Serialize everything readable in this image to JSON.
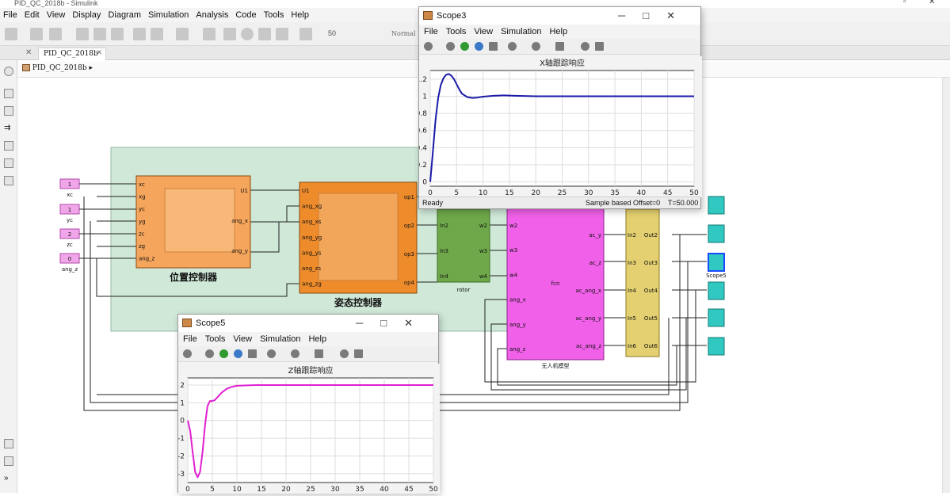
{
  "window": {
    "title": "PID_QC_2018b - Simulink",
    "menu": [
      "File",
      "Edit",
      "View",
      "Display",
      "Diagram",
      "Simulation",
      "Analysis",
      "Code",
      "Tools",
      "Help"
    ],
    "toolbar": {
      "stop_time": "50",
      "sim_mode": "Normal"
    },
    "tab_label": "PID_QC_2018b",
    "breadcrumb": "PID_QC_2018b"
  },
  "model": {
    "inputs": [
      {
        "value": "1",
        "name": "xc"
      },
      {
        "value": "1",
        "name": "yc"
      },
      {
        "value": "2",
        "name": "zc"
      },
      {
        "value": "0",
        "name": "ang_z"
      }
    ],
    "pos_controller": {
      "label": "位置控制器",
      "ports_in": [
        "xc",
        "xg",
        "yc",
        "yg",
        "zc",
        "zg",
        "ang_z"
      ],
      "ports_out": [
        "U1",
        "ang_x",
        "ang_y"
      ]
    },
    "att_controller": {
      "label": "姿态控制器",
      "ports_in": [
        "U1",
        "ang_xg",
        "ang_xs",
        "ang_yg",
        "ang_ys",
        "ang_zs",
        "ang_zg"
      ],
      "ports_out": [
        "op1",
        "op2",
        "op3",
        "op4"
      ]
    },
    "rotor": {
      "label": "rotor",
      "ports_in": [
        "In2",
        "In3",
        "In4"
      ],
      "ports_out": [
        "w2",
        "w3",
        "w4"
      ]
    },
    "uav": {
      "label": "无人机模型",
      "fcn": "fcn",
      "ports_in": [
        "w2",
        "w3",
        "w4",
        "ang_x",
        "ang_y",
        "ang_z"
      ],
      "ports_out": [
        "ac_y",
        "ac_z",
        "ac_ang_x",
        "ac_ang_y",
        "ac_ang_z"
      ]
    },
    "demux": {
      "ports_in": [
        "In2",
        "In3",
        "In4",
        "In5",
        "In6"
      ],
      "ports_out": [
        "Out2",
        "Out3",
        "Out4",
        "Out5",
        "Out6"
      ]
    },
    "scope_highlight_label": "Scope5"
  },
  "scope3": {
    "title": "Scope3",
    "menu": [
      "File",
      "Tools",
      "View",
      "Simulation",
      "Help"
    ],
    "status": {
      "ready": "Ready",
      "mode": "Sample based",
      "offset": "Offset=0",
      "time": "T=50.000"
    }
  },
  "scope5": {
    "title": "Scope5",
    "menu": [
      "File",
      "Tools",
      "View",
      "Simulation",
      "Help"
    ]
  },
  "chart_data": [
    {
      "type": "line",
      "title": "X轴跟踪响应",
      "xlabel": "",
      "ylabel": "",
      "xlim": [
        0,
        50
      ],
      "ylim": [
        -0.05,
        1.3
      ],
      "xticks": [
        0,
        5,
        10,
        15,
        20,
        25,
        30,
        35,
        40,
        45,
        50
      ],
      "yticks": [
        0,
        0.2,
        0.4,
        0.6,
        0.8,
        1,
        1.2
      ],
      "grid": true,
      "series": [
        {
          "color": "#1a1aa8",
          "x": [
            0,
            0.5,
            1,
            1.5,
            2,
            2.5,
            3,
            3.5,
            4,
            4.5,
            5,
            5.5,
            6,
            7,
            8,
            9,
            10,
            12,
            14,
            16,
            20,
            25,
            30,
            40,
            50
          ],
          "y": [
            0,
            0.35,
            0.72,
            0.98,
            1.13,
            1.21,
            1.25,
            1.26,
            1.24,
            1.2,
            1.14,
            1.08,
            1.03,
            0.99,
            0.98,
            0.985,
            0.995,
            1.005,
            1.01,
            1.005,
            1.0,
            1.0,
            1.0,
            1.0,
            1.0
          ]
        }
      ]
    },
    {
      "type": "line",
      "title": "Z轴跟踪响应",
      "xlabel": "",
      "ylabel": "",
      "xlim": [
        0,
        50
      ],
      "ylim": [
        -3.5,
        2.4
      ],
      "xticks": [
        0,
        5,
        10,
        15,
        20,
        25,
        30,
        35,
        40,
        45,
        50
      ],
      "yticks": [
        -3,
        -2,
        -1,
        0,
        1,
        2
      ],
      "grid": true,
      "series": [
        {
          "color": "#e020d0",
          "x": [
            0,
            0.5,
            1,
            1.5,
            2,
            2.5,
            3,
            3.5,
            4,
            4.5,
            5,
            5.5,
            6,
            7,
            8,
            9,
            10,
            12,
            14,
            16,
            20,
            30,
            40,
            50
          ],
          "y": [
            0,
            -0.6,
            -1.8,
            -2.9,
            -3.2,
            -2.9,
            -1.8,
            -0.3,
            0.8,
            1.1,
            1.1,
            1.15,
            1.3,
            1.6,
            1.8,
            1.9,
            1.96,
            1.98,
            2.0,
            2.0,
            2.0,
            2.0,
            2.0,
            2.0
          ]
        }
      ]
    }
  ]
}
